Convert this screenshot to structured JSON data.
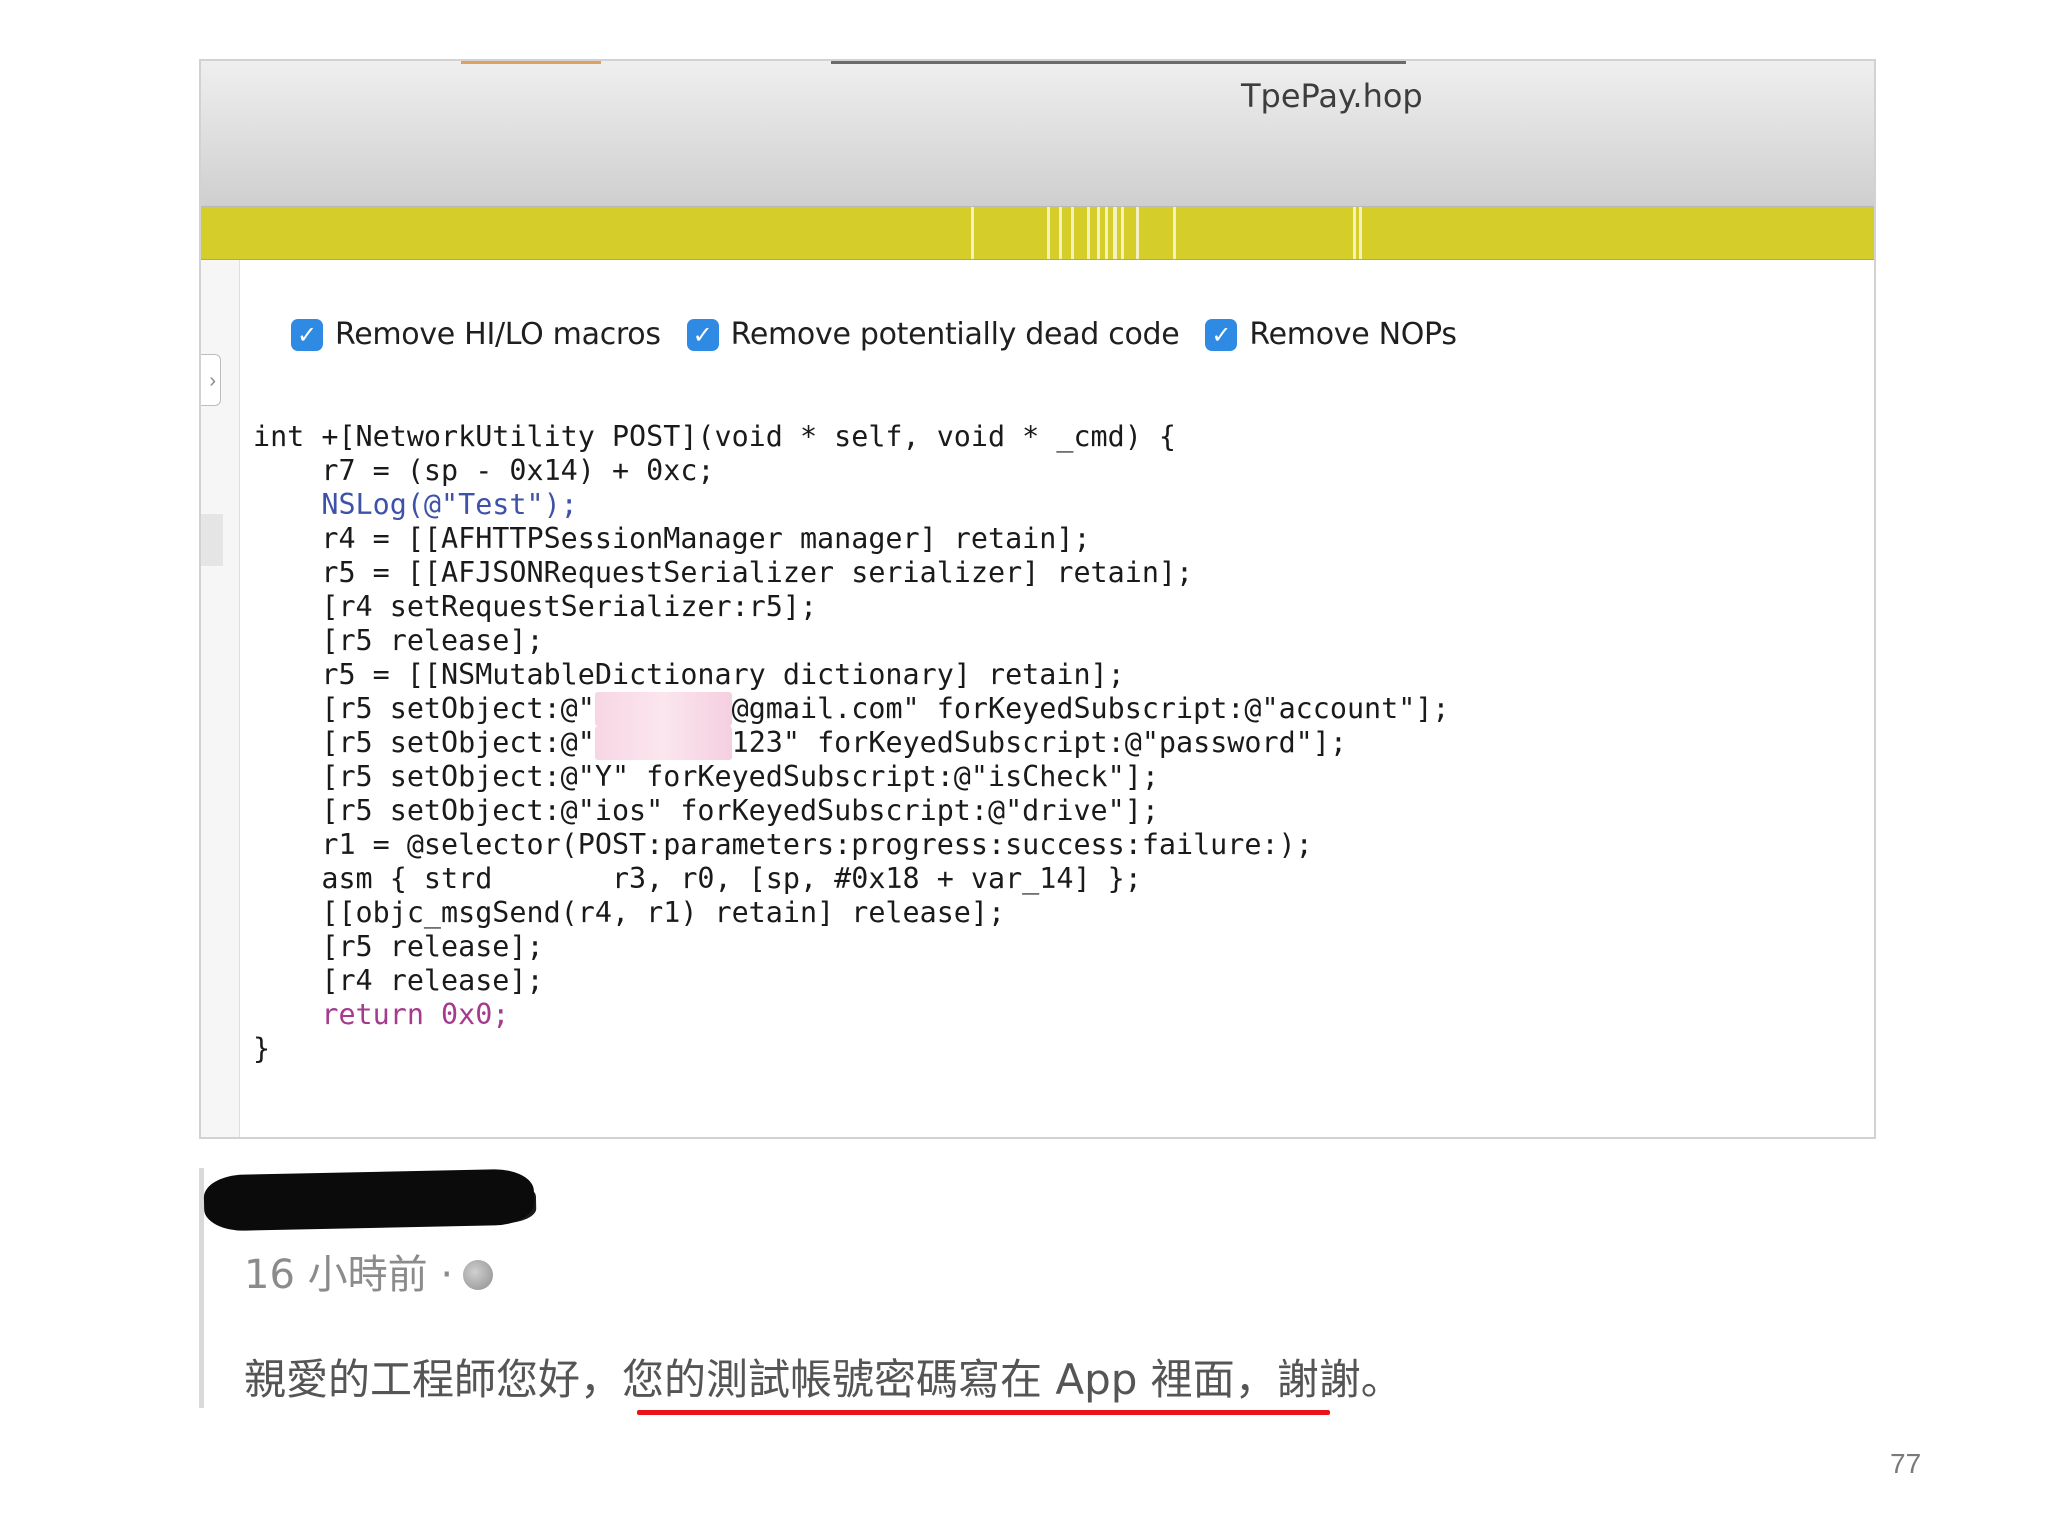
{
  "window": {
    "title": "TpePay.hop"
  },
  "options": [
    {
      "label": "Remove HI/LO macros",
      "checked": true
    },
    {
      "label": "Remove potentially dead code",
      "checked": true
    },
    {
      "label": "Remove NOPs",
      "checked": true
    }
  ],
  "code": {
    "lines": [
      "int +[NetworkUtility POST](void * self, void * _cmd) {",
      "    r7 = (sp - 0x14) + 0xc;",
      "    NSLog(@\"Test\");",
      "    r4 = [[AFHTTPSessionManager manager] retain];",
      "    r5 = [[AFJSONRequestSerializer serializer] retain];",
      "    [r4 setRequestSerializer:r5];",
      "    [r5 release];",
      "    r5 = [[NSMutableDictionary dictionary] retain];",
      "    [r5 setObject:@\"",
      "@gmail.com\" forKeyedSubscript:@\"account\"];",
      "    [r5 setObject:@\"",
      "123\" forKeyedSubscript:@\"password\"];",
      "    [r5 setObject:@\"Y\" forKeyedSubscript:@\"isCheck\"];",
      "    [r5 setObject:@\"ios\" forKeyedSubscript:@\"drive\"];",
      "    r1 = @selector(POST:parameters:progress:success:failure:);",
      "    asm { strd       r3, r0, [sp, #0x18 + var_14] };",
      "    [[objc_msgSend(r4, r1) retain] release];",
      "    [r5 release];",
      "    [r4 release];",
      "    return 0x0;",
      "}"
    ]
  },
  "post": {
    "time": "16 小時前 ·",
    "comment": "親愛的工程師您好，您的測試帳號密碼寫在 App 裡面，謝謝。"
  },
  "slide": {
    "page_number": "77"
  },
  "icons": {
    "check": "check-icon",
    "globe": "globe-icon"
  },
  "colors": {
    "nav_yellow": "#d4cd2a",
    "checkbox_blue": "#2f8ae4",
    "underline_red": "#e8141a"
  }
}
